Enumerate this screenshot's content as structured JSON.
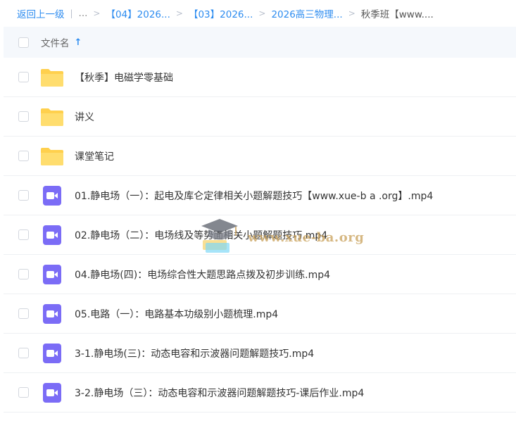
{
  "breadcrumb": {
    "back": "返回上一级",
    "ellipsis": "...",
    "crumbs": [
      "【04】2026...",
      "【03】2026...",
      "2026高三物理..."
    ],
    "current": "秋季班【www...."
  },
  "header": {
    "name_label": "文件名"
  },
  "files": [
    {
      "name": "【秋季】电磁学零基础",
      "type": "folder"
    },
    {
      "name": "讲义",
      "type": "folder"
    },
    {
      "name": "课堂笔记",
      "type": "folder"
    },
    {
      "name": "01.静电场（一）：起电及库仑定律相关小题解题技巧【www.xue-b a .org】.mp4",
      "type": "video"
    },
    {
      "name": "02.静电场（二）：电场线及等势面相关小题解题技巧.mp4",
      "type": "video"
    },
    {
      "name": "04.静电场(四)：电场综合性大题思路点拨及初步训练.mp4",
      "type": "video"
    },
    {
      "name": "05.电路（一）：电路基本功级别小题梳理.mp4",
      "type": "video"
    },
    {
      "name": "3-1.静电场(三)：动态电容和示波器问题解题技巧.mp4",
      "type": "video"
    },
    {
      "name": "3-2.静电场（三）：动态电容和示波器问题解题技巧-课后作业.mp4",
      "type": "video"
    }
  ],
  "watermark": {
    "text": "www.xue-ba.org"
  },
  "colors": {
    "accent": "#2d8cf0",
    "folder": "#ffd04d",
    "video": "#7b6cf6"
  }
}
